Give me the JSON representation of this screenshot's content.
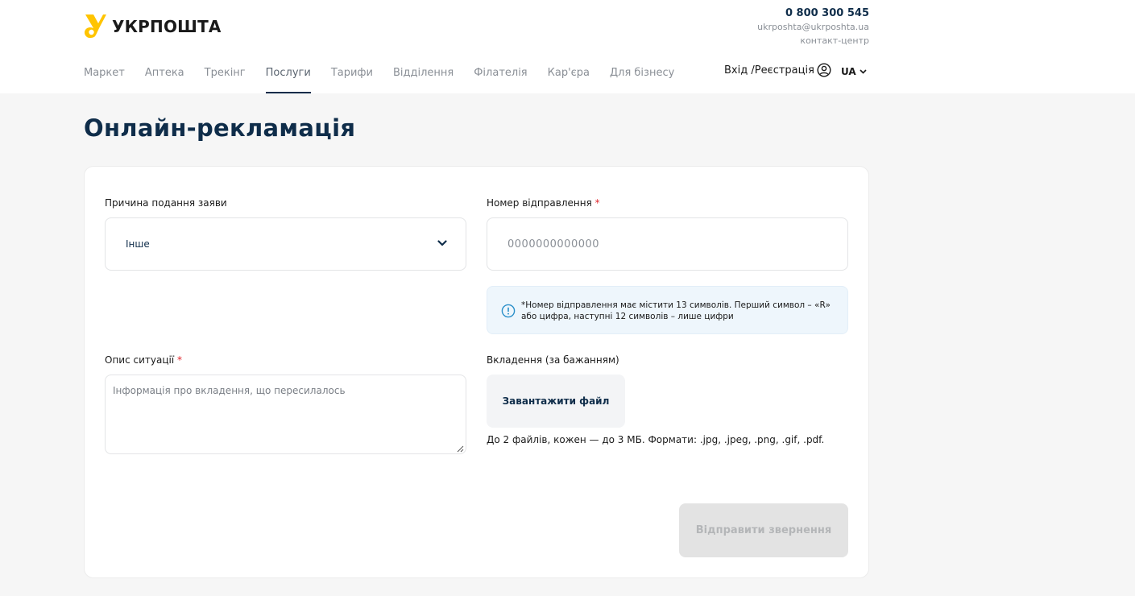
{
  "header": {
    "logo_text": "УКРПОШТА",
    "phone": "0 800 300 545",
    "email": "ukrposhta@ukrposhta.ua",
    "contact_center": "контакт-центр",
    "nav": [
      {
        "label": "Маркет",
        "active": false
      },
      {
        "label": "Аптека",
        "active": false
      },
      {
        "label": "Трекінг",
        "active": false
      },
      {
        "label": "Послуги",
        "active": true
      },
      {
        "label": "Тарифи",
        "active": false
      },
      {
        "label": "Відділення",
        "active": false
      },
      {
        "label": "Філателія",
        "active": false
      },
      {
        "label": "Кар'єра",
        "active": false
      },
      {
        "label": "Для бізнесу",
        "active": false
      }
    ],
    "login_label": "Вхід /Реєстрація",
    "lang": "UA"
  },
  "page_title": "Онлайн-рекламація",
  "form": {
    "reason": {
      "label": "Причина подання заяви",
      "value": "Інше"
    },
    "tracking": {
      "label": "Номер відправлення",
      "required_mark": "*",
      "placeholder": "0000000000000"
    },
    "info_text": "*Номер відправлення має містити 13 символів. Перший символ – «R» або цифра, наступні 12 символів – лише цифри",
    "description": {
      "label": "Опис ситуації",
      "required_mark": "*",
      "placeholder": "Інформація про вкладення, що пересилалось"
    },
    "attachment": {
      "label": "Вкладення (за бажанням)",
      "button": "Завантажити файл",
      "hint": "До 2 файлів, кожен — до 3 МБ. Формати: .jpg, .jpeg, .png, .gif, .pdf."
    },
    "submit_label": "Відправити звернення"
  },
  "colors": {
    "brand_yellow": "#ffc400",
    "brand_navy": "#0f2d4a",
    "required": "#e0262d",
    "info_bg": "#eef6fc",
    "disabled_btn": "#e3e3e3"
  }
}
